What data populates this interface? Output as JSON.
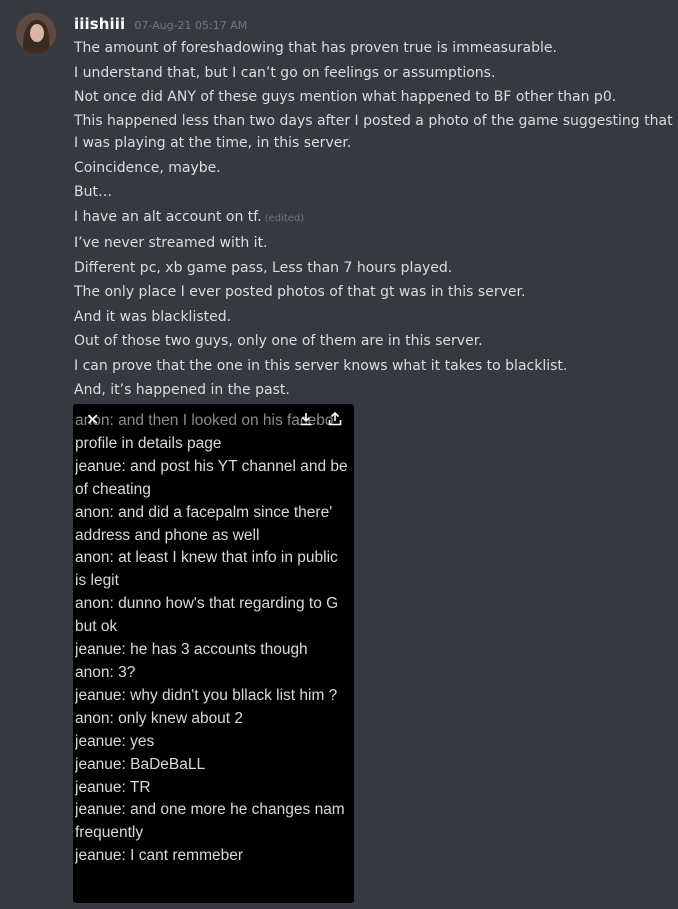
{
  "message": {
    "username": "iiishiii",
    "timestamp": "07-Aug-21 05:17 AM",
    "edited_label": "(edited)",
    "lines": [
      "The amount of foreshadowing that has proven true is immeasurable.",
      "I understand that, but I can’t go on feelings or assumptions.",
      "Not once did ANY of these guys mention what happened to BF other than p0.",
      "This happened less than two days after I posted a photo of the game suggesting that I was playing at the time, in this server.",
      "Coincidence, maybe.",
      "But…",
      "I have an alt account on tf.",
      "I’ve never streamed with it.",
      "Different pc, xb game pass, Less than 7 hours played.",
      "The only place I ever posted photos of that gt was in this server.",
      "And it was blacklisted.",
      "Out of those two guys, only one of them are in this server.",
      "I can prove that the one in this server knows what it takes to blacklist.",
      "And, it’s happened in the past."
    ]
  },
  "attachment": {
    "icons": [
      "close-icon",
      "download-icon",
      "share-icon"
    ],
    "close_glyph": "✕",
    "chat_lines": [
      "anon:   and then I looked on his facebo",
      "profile in details page",
      "jeanue: and post his YT channel and be",
      "of cheating",
      "anon:   and did a facepalm since there'",
      "address and phone as well",
      "anon:   at least I knew that info in public",
      "is legit",
      "anon:   dunno how's that regarding to G",
      "but ok",
      "jeanue: he has 3 accounts though",
      "anon:   3?",
      "jeanue: why didn't you bllack list him ?",
      "anon:   only knew about 2",
      "jeanue: yes",
      "jeanue: BaDeBaLL",
      "jeanue: TR",
      "jeanue: and one more he changes nam",
      "frequently",
      "jeanue: I cant remmeber"
    ]
  },
  "colors": {
    "background": "#36393f",
    "username": "#ffffff",
    "timestamp": "#72767d",
    "text": "#dcddde",
    "attachment_bg": "#000000"
  }
}
